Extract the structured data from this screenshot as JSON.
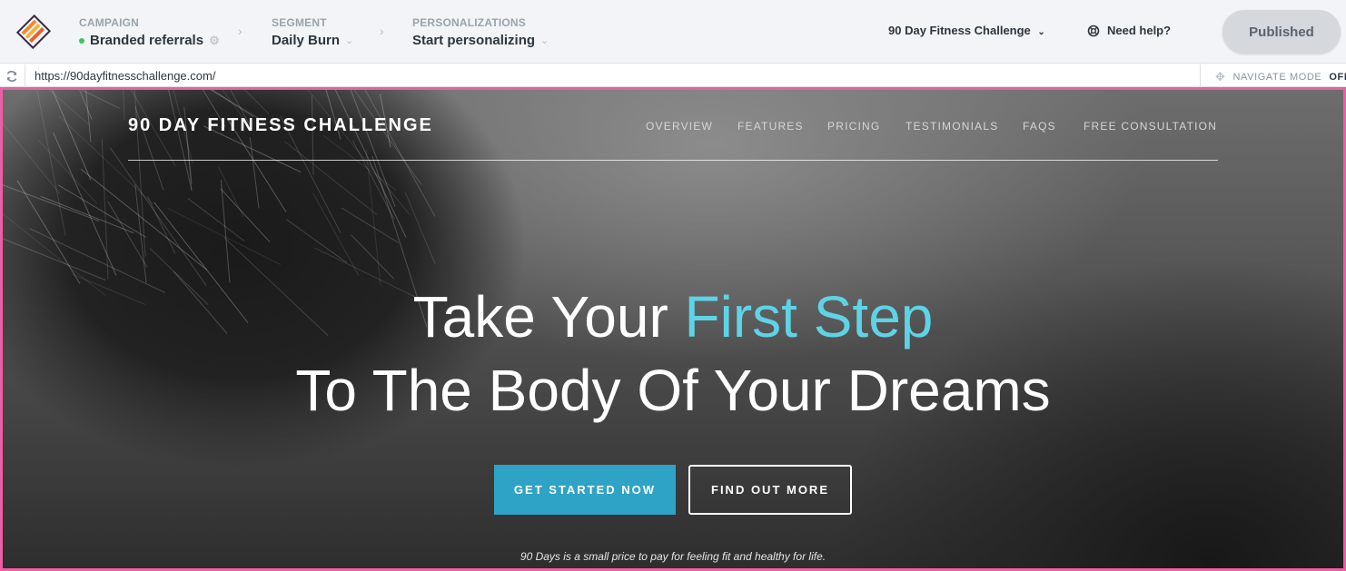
{
  "topbar": {
    "campaign": {
      "label": "CAMPAIGN",
      "value": "Branded referrals"
    },
    "segment": {
      "label": "SEGMENT",
      "value": "Daily Burn"
    },
    "personalizations": {
      "label": "PERSONALIZATIONS",
      "value": "Start personalizing"
    },
    "site_select": "90 Day Fitness Challenge",
    "help": "Need help?",
    "publish": "Published",
    "colors": {
      "status_dot": "#3cc36c",
      "frame_border": "#ec5fa3"
    }
  },
  "urlbar": {
    "url": "https://90dayfitnesschallenge.com/",
    "navigate_label": "NAVIGATE MODE",
    "navigate_state": "OFF"
  },
  "site": {
    "brand": "90 DAY FITNESS CHALLENGE",
    "nav": [
      "OVERVIEW",
      "FEATURES",
      "PRICING",
      "TESTIMONIALS",
      "FAQS",
      "FREE CONSULTATION"
    ],
    "headline_part1": "Take Your ",
    "headline_accent": "First Step",
    "headline_line2": "To The Body Of Your Dreams",
    "cta_primary": "GET STARTED NOW",
    "cta_secondary": "FIND OUT MORE",
    "tagline": "90 Days is a small price to pay for feeling fit and healthy for life.",
    "colors": {
      "accent": "#5fd3e6",
      "primary_button": "#2fa3c6"
    }
  }
}
